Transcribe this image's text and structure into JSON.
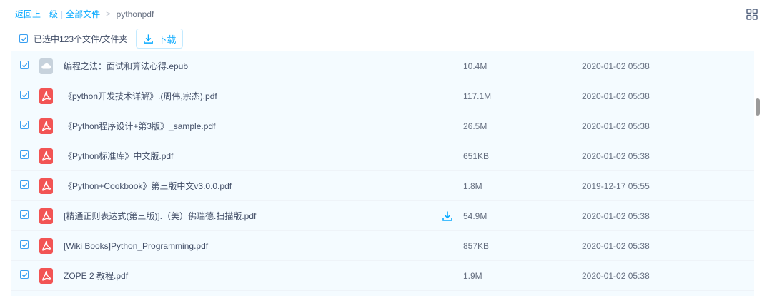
{
  "breadcrumb": {
    "back_label": "返回上一级",
    "separator": "|",
    "all_files_label": "全部文件",
    "arrow": ">",
    "current": "pythonpdf"
  },
  "toolbar": {
    "selection_label": "已选中123个文件/文件夹",
    "download_label": "下载",
    "select_all_checked": true
  },
  "colors": {
    "accent": "#09aaff",
    "pdf_icon": "#f25454",
    "epub_icon": "#c7d2dc",
    "selected_row_bg": "#f4fbff"
  },
  "files": [
    {
      "name": "编程之法：面试和算法心得.epub",
      "type": "epub",
      "size": "10.4M",
      "date": "2020-01-02 05:38",
      "checked": true
    },
    {
      "name": "《python开发技术详解》.(周伟,宗杰).pdf",
      "type": "pdf",
      "size": "117.1M",
      "date": "2020-01-02 05:38",
      "checked": true
    },
    {
      "name": "《Python程序设计+第3版》_sample.pdf",
      "type": "pdf",
      "size": "26.5M",
      "date": "2020-01-02 05:38",
      "checked": true
    },
    {
      "name": "《Python标准库》中文版.pdf",
      "type": "pdf",
      "size": "651KB",
      "date": "2020-01-02 05:38",
      "checked": true
    },
    {
      "name": "《Python+Cookbook》第三版中文v3.0.0.pdf",
      "type": "pdf",
      "size": "1.8M",
      "date": "2019-12-17 05:55",
      "checked": true
    },
    {
      "name": "[精通正则表达式(第三版)].（美）佛瑞德.扫描版.pdf",
      "type": "pdf",
      "size": "54.9M",
      "date": "2020-01-02 05:38",
      "checked": true,
      "hover_download": true
    },
    {
      "name": "[Wiki Books]Python_Programming.pdf",
      "type": "pdf",
      "size": "857KB",
      "date": "2020-01-02 05:38",
      "checked": true
    },
    {
      "name": "ZOPE 2 教程.pdf",
      "type": "pdf",
      "size": "1.9M",
      "date": "2020-01-02 05:38",
      "checked": true
    }
  ]
}
